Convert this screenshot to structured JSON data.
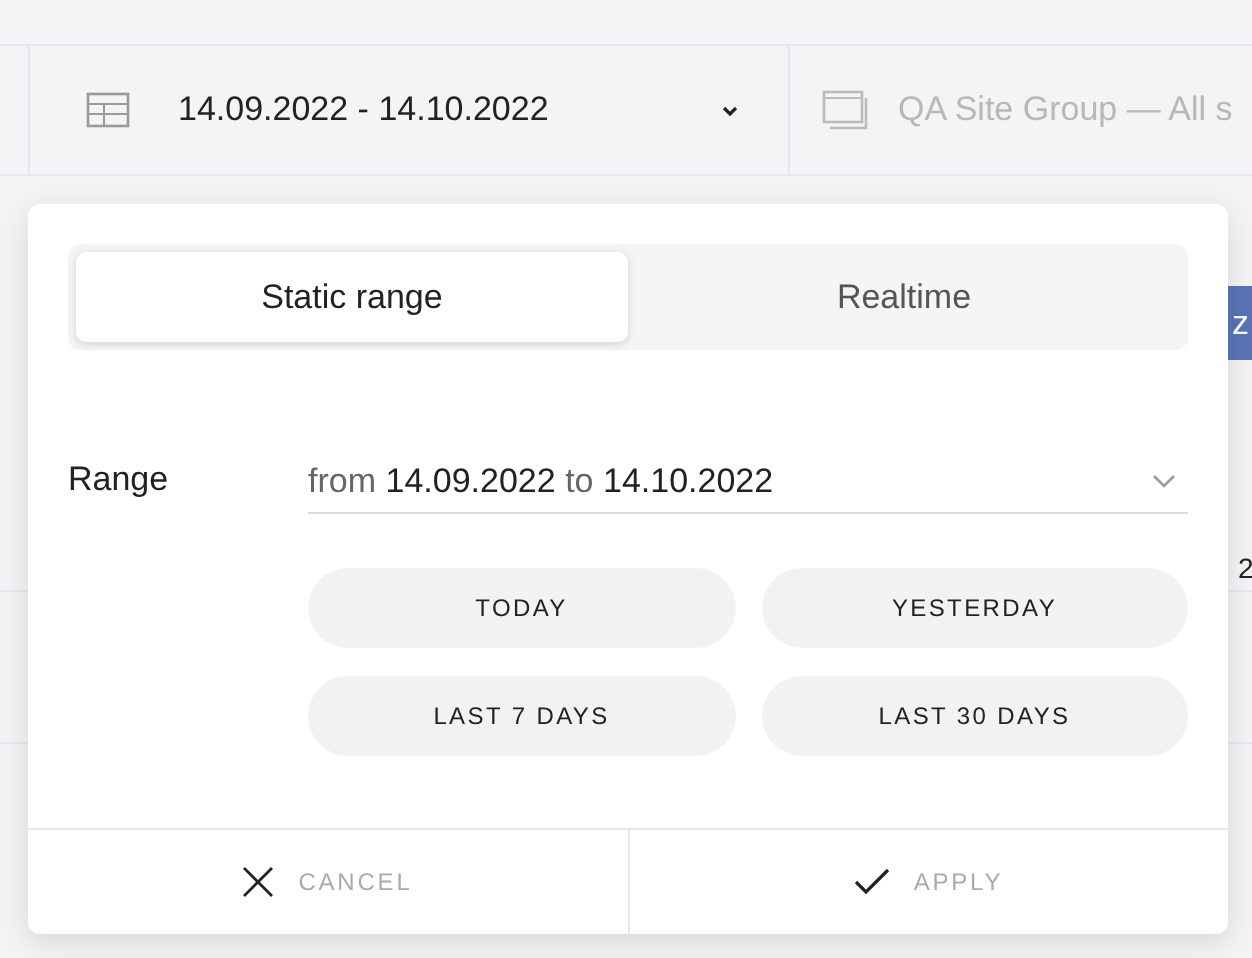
{
  "toolbar": {
    "date_range": "14.09.2022 - 14.10.2022",
    "site_group": "QA Site Group — All s"
  },
  "background": {
    "button_fragment": "z",
    "cell_fragment": "2"
  },
  "popup": {
    "tabs": [
      {
        "label": "Static range",
        "selected": true
      },
      {
        "label": "Realtime",
        "selected": false
      }
    ],
    "range": {
      "label": "Range",
      "value_parts": [
        {
          "kind": "connector",
          "text": "from"
        },
        {
          "kind": "date",
          "text": "14.09.2022"
        },
        {
          "kind": "connector",
          "text": "to"
        },
        {
          "kind": "date",
          "text": "14.10.2022"
        }
      ]
    },
    "presets": [
      "TODAY",
      "YESTERDAY",
      "LAST 7 DAYS",
      "LAST 30 DAYS"
    ],
    "footer": [
      {
        "kind": "cancel",
        "label": "CANCEL"
      },
      {
        "kind": "apply",
        "label": "APPLY"
      }
    ]
  }
}
